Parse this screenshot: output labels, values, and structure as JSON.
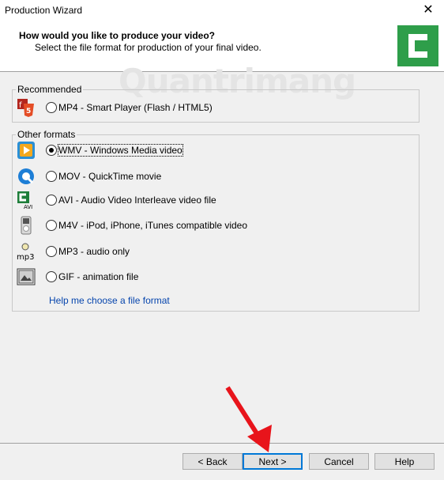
{
  "window": {
    "title": "Production Wizard",
    "close_glyph": "✕"
  },
  "header": {
    "question": "How would you like to produce your video?",
    "subtitle": "Select the file format for production of your final video.",
    "logo_icon": "camtasia-logo-icon",
    "watermark": "Quantrimang"
  },
  "recommended": {
    "label": "Recommended",
    "items": [
      {
        "label": "MP4 - Smart Player (Flash / HTML5)",
        "icon": "html5-flash-icon",
        "selected": false
      }
    ]
  },
  "other": {
    "label": "Other formats",
    "items": [
      {
        "label": "WMV - Windows Media video",
        "icon": "windows-media-icon",
        "selected": true
      },
      {
        "label": "MOV - QuickTime movie",
        "icon": "quicktime-icon",
        "selected": false
      },
      {
        "label": "AVI - Audio Video Interleave video file",
        "icon": "avi-icon",
        "selected": false
      },
      {
        "label": "M4V - iPod, iPhone, iTunes compatible video",
        "icon": "ipod-icon",
        "selected": false
      },
      {
        "label": "MP3 - audio only",
        "icon": "mp3-icon",
        "selected": false
      },
      {
        "label": "GIF - animation file",
        "icon": "gif-icon",
        "selected": false
      }
    ]
  },
  "help_link": "Help me choose a file format",
  "buttons": {
    "back": "< Back",
    "next": "Next >",
    "cancel": "Cancel",
    "help": "Help"
  },
  "colors": {
    "accent": "#0078d7",
    "logo": "#1e7e3a",
    "annotation_arrow": "#e8141b"
  }
}
